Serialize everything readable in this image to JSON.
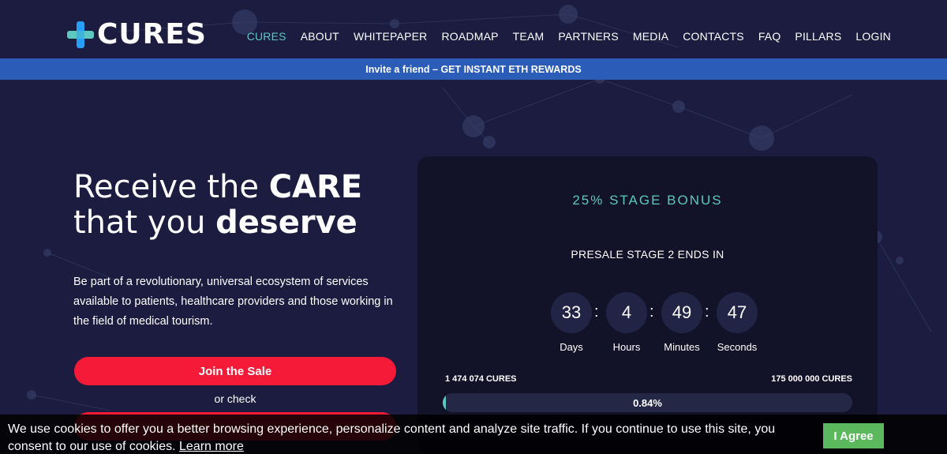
{
  "brand": {
    "name": "CURES",
    "accent": "#5cc8c0",
    "cross_colors": [
      "#2a9df4",
      "#5cc8c0"
    ]
  },
  "nav": {
    "items": [
      {
        "label": "CURES",
        "active": true
      },
      {
        "label": "ABOUT"
      },
      {
        "label": "WHITEPAPER"
      },
      {
        "label": "ROADMAP"
      },
      {
        "label": "TEAM"
      },
      {
        "label": "PARTNERS"
      },
      {
        "label": "MEDIA"
      },
      {
        "label": "CONTACTS"
      },
      {
        "label": "FAQ"
      },
      {
        "label": "PILLARS"
      },
      {
        "label": "LOGIN"
      }
    ]
  },
  "promo": {
    "text": "Invite a friend – GET INSTANT ETH REWARDS",
    "color": "#2a5cb8"
  },
  "hero": {
    "title_line1_prefix": "Receive the ",
    "title_line1_bold": "CARE",
    "title_line2_prefix": "that you ",
    "title_line2_bold": "deserve",
    "description": "Be part of a revolutionary, universal ecosystem of services available to patients, healthcare providers and those working in the field of medical tourism.",
    "join_button": "Join the Sale",
    "or_check": "or check",
    "button_color": "#f51a37"
  },
  "sale": {
    "bonus": "25% STAGE BONUS",
    "ends_label": "PRESALE STAGE 2 ENDS IN",
    "countdown": [
      {
        "value": "33",
        "label": "Days"
      },
      {
        "value": "4",
        "label": "Hours"
      },
      {
        "value": "49",
        "label": "Minutes"
      },
      {
        "value": "47",
        "label": "Seconds"
      }
    ],
    "separator": ":",
    "raised": "1 474 074 CURES",
    "goal": "175 000 000 CURES",
    "progress_text": "0.84%",
    "progress_fraction": 0.0084
  },
  "cookie": {
    "text": "We use cookies to offer you a better browsing experience, personalize content and analyze site traffic. If you continue to use this site, you consent to our use of cookies.",
    "link": "Learn more",
    "agree": "I Agree",
    "agree_color": "#5cb85c"
  }
}
